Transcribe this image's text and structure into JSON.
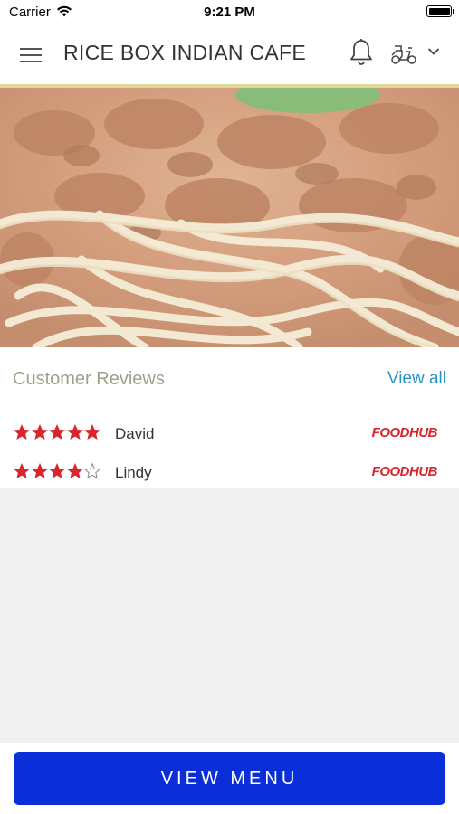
{
  "status_bar": {
    "carrier": "Carrier",
    "time": "9:21 PM"
  },
  "header": {
    "title": "RICE BOX INDIAN CAFE",
    "menu_icon": "hamburger-menu-icon",
    "notification_icon": "bell-icon",
    "delivery_icon": "scooter-icon",
    "dropdown_icon": "chevron-down-icon"
  },
  "hero": {
    "image": "spaghetti-bolognese-photo"
  },
  "reviews": {
    "title": "Customer Reviews",
    "view_all_label": "View all",
    "items": [
      {
        "name": "David",
        "rating": 5,
        "source": "FOODHUB"
      },
      {
        "name": "Lindy",
        "rating": 4,
        "source": "FOODHUB"
      }
    ]
  },
  "bottom": {
    "view_menu_label": "VIEW MENU"
  },
  "colors": {
    "accent_blue": "#0a2ed8",
    "link_blue": "#2a94c4",
    "star_red": "#d8262c",
    "header_line": "#ddd89a"
  }
}
